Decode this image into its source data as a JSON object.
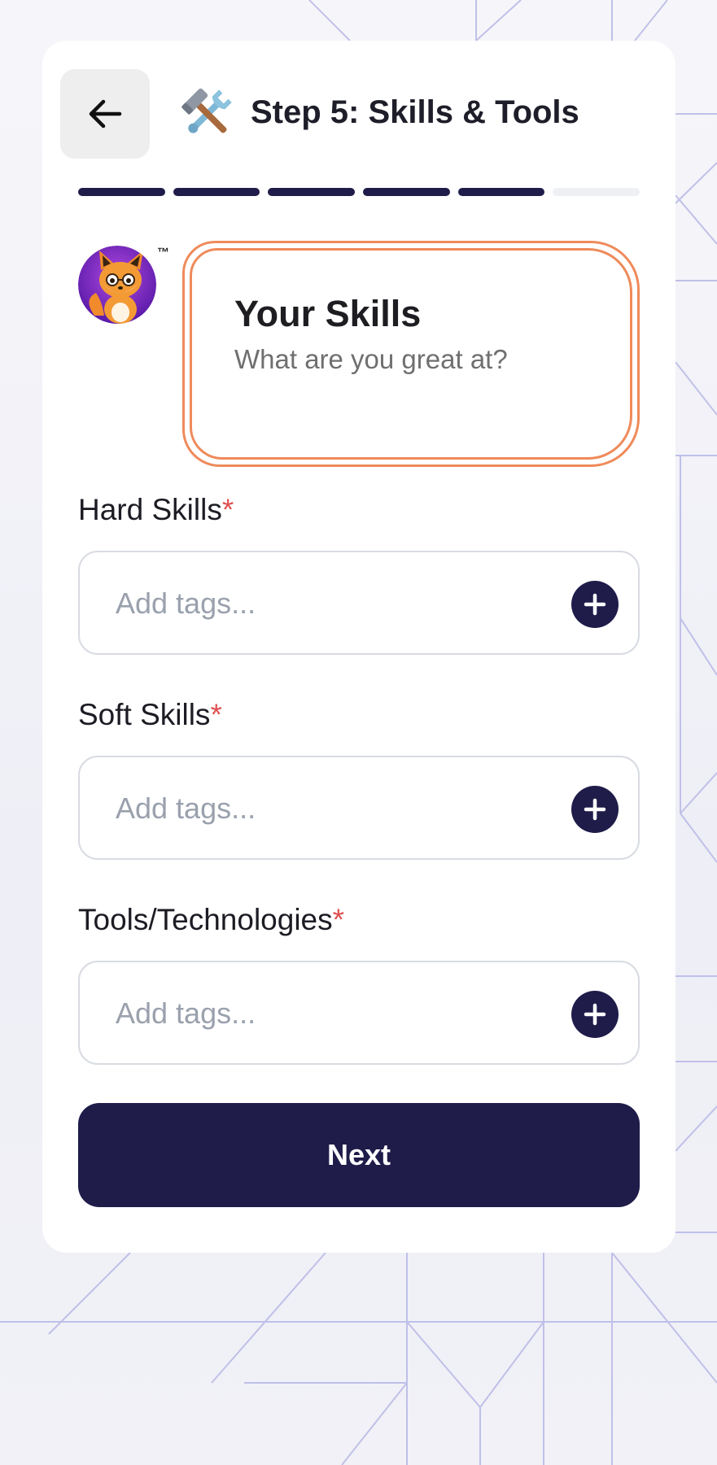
{
  "header": {
    "title": "Step 5: Skills & Tools",
    "icon": "hammer-and-wrench-icon"
  },
  "progress": {
    "total_steps": 6,
    "completed_steps": 5,
    "active_color": "#1f1c4a",
    "inactive_color": "#eef0f4"
  },
  "mascot": {
    "icon": "fox-mascot-icon",
    "trademark": "™"
  },
  "intro": {
    "title": "Your Skills",
    "subtitle": "What are you great at?",
    "border_color": "#ef8a5a"
  },
  "fields": [
    {
      "label": "Hard Skills",
      "required_mark": "*",
      "placeholder": "Add tags...",
      "value": ""
    },
    {
      "label": "Soft Skills",
      "required_mark": "*",
      "placeholder": "Add tags...",
      "value": ""
    },
    {
      "label": "Tools/Technologies",
      "required_mark": "*",
      "placeholder": "Add tags...",
      "value": ""
    }
  ],
  "next_button": {
    "label": "Next"
  },
  "colors": {
    "accent": "#1f1c4a",
    "required": "#e05050",
    "background": "#f3f3f8"
  }
}
